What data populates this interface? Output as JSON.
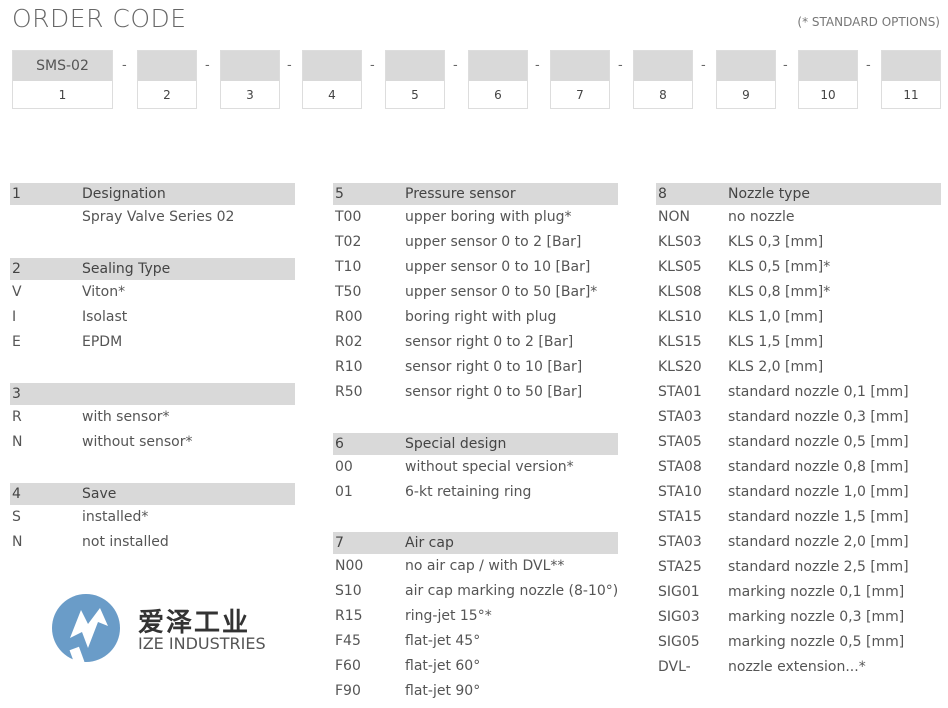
{
  "header": {
    "title": "ORDER CODE",
    "standard_note": "(* STANDARD OPTIONS)"
  },
  "code_boxes": [
    {
      "value": "SMS-02",
      "num": "1"
    },
    {
      "value": "",
      "num": "2"
    },
    {
      "value": "",
      "num": "3"
    },
    {
      "value": "",
      "num": "4"
    },
    {
      "value": "",
      "num": "5"
    },
    {
      "value": "",
      "num": "6"
    },
    {
      "value": "",
      "num": "7"
    },
    {
      "value": "",
      "num": "8"
    },
    {
      "value": "",
      "num": "9"
    },
    {
      "value": "",
      "num": "10"
    },
    {
      "value": "",
      "num": "11"
    }
  ],
  "separator": "-",
  "sections": [
    {
      "num": "1",
      "title": "Designation",
      "rows": [
        [
          "",
          "Spray Valve Series 02"
        ]
      ]
    },
    {
      "num": "2",
      "title": "Sealing Type",
      "rows": [
        [
          "V",
          "Viton*"
        ],
        [
          "I",
          "Isolast"
        ],
        [
          "E",
          "EPDM"
        ]
      ]
    },
    {
      "num": "3",
      "title": "",
      "rows": [
        [
          "R",
          "with sensor*"
        ],
        [
          "N",
          "without sensor*"
        ]
      ]
    },
    {
      "num": "4",
      "title": "Save",
      "rows": [
        [
          "S",
          "installed*"
        ],
        [
          "N",
          "not installed"
        ]
      ]
    },
    {
      "num": "5",
      "title": "Pressure sensor",
      "rows": [
        [
          "T00",
          "upper boring with plug*"
        ],
        [
          "T02",
          "upper sensor 0 to 2 [Bar]"
        ],
        [
          "T10",
          "upper sensor 0 to 10 [Bar]"
        ],
        [
          "T50",
          "upper sensor 0 to 50 [Bar]*"
        ],
        [
          "R00",
          "boring right with plug"
        ],
        [
          "R02",
          "sensor right 0 to 2 [Bar]"
        ],
        [
          "R10",
          "sensor right 0 to 10 [Bar]"
        ],
        [
          "R50",
          "sensor right 0 to 50 [Bar]"
        ]
      ]
    },
    {
      "num": "6",
      "title": "Special design",
      "rows": [
        [
          "00",
          "without special version*"
        ],
        [
          "01",
          "6-kt retaining ring"
        ]
      ]
    },
    {
      "num": "7",
      "title": "Air cap",
      "rows": [
        [
          "N00",
          "no air cap / with DVL**"
        ],
        [
          "S10",
          "air cap marking nozzle (8-10°)"
        ],
        [
          "R15",
          "ring-jet 15°*"
        ],
        [
          "F45",
          "flat-jet 45°"
        ],
        [
          "F60",
          "flat-jet 60°"
        ],
        [
          "F90",
          "flat-jet 90°"
        ]
      ]
    },
    {
      "num": "8",
      "title": "Nozzle type",
      "rows": [
        [
          "NON",
          "no nozzle"
        ],
        [
          "KLS03",
          "KLS 0,3 [mm]"
        ],
        [
          "KLS05",
          "KLS 0,5 [mm]*"
        ],
        [
          "KLS08",
          "KLS 0,8 [mm]*"
        ],
        [
          "KLS10",
          "KLS 1,0 [mm]"
        ],
        [
          "KLS15",
          "KLS 1,5 [mm]"
        ],
        [
          "KLS20",
          "KLS 2,0 [mm]"
        ],
        [
          "STA01",
          "standard nozzle 0,1 [mm]"
        ],
        [
          "STA03",
          "standard nozzle 0,3 [mm]"
        ],
        [
          "STA05",
          "standard nozzle 0,5 [mm]"
        ],
        [
          "STA08",
          "standard nozzle 0,8 [mm]"
        ],
        [
          "STA10",
          "standard nozzle 1,0 [mm]"
        ],
        [
          "STA15",
          "standard nozzle 1,5 [mm]"
        ],
        [
          "STA03",
          "standard nozzle 2,0 [mm]"
        ],
        [
          "STA25",
          "standard nozzle 2,5 [mm]"
        ],
        [
          "SIG01",
          "marking nozzle 0,1 [mm]"
        ],
        [
          "SIG03",
          "marking nozzle 0,3 [mm]"
        ],
        [
          "SIG05",
          "marking nozzle 0,5 [mm]"
        ],
        [
          "DVL-",
          "nozzle extension...*"
        ]
      ]
    }
  ],
  "watermark": {
    "cn": "爱泽工业",
    "en": "IZE INDUSTRIES",
    "color": "#6a9cc8"
  }
}
